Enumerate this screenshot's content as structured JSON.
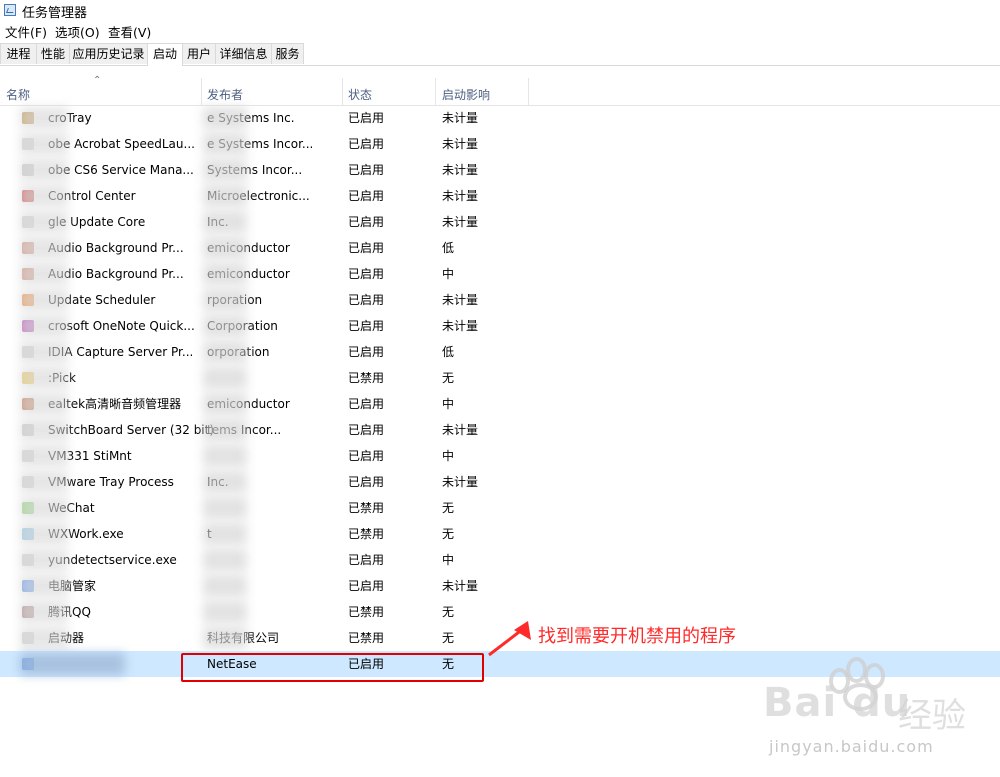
{
  "window": {
    "title": "任务管理器",
    "icon": "task-manager-icon"
  },
  "menu": [
    "文件(F)",
    "选项(O)",
    "查看(V)"
  ],
  "tabs": [
    "进程",
    "性能",
    "应用历史记录",
    "启动",
    "用户",
    "详细信息",
    "服务"
  ],
  "active_tab": "启动",
  "columns": [
    "名称",
    "发布者",
    "状态",
    "启动影响"
  ],
  "rows": [
    {
      "name": "croTray",
      "publisher": "e Systems Inc.",
      "status": "已启用",
      "impact": "未计量",
      "icon_color": "#c8a46a"
    },
    {
      "name": "obe Acrobat SpeedLau...",
      "publisher": "e Systems Incor...",
      "status": "已启用",
      "impact": "未计量",
      "icon_color": "#d9d9d9"
    },
    {
      "name": "obe CS6 Service Mana...",
      "publisher": "Systems Incor...",
      "status": "已启用",
      "impact": "未计量",
      "icon_color": "#cfcfcf"
    },
    {
      "name": "Control Center",
      "publisher": "Microelectronic...",
      "status": "已启用",
      "impact": "未计量",
      "icon_color": "#d36b6b"
    },
    {
      "name": "gle Update Core",
      "publisher": "Inc.",
      "status": "已启用",
      "impact": "未计量",
      "icon_color": "#d9d9d9"
    },
    {
      "name": "Audio Background Pr...",
      "publisher": "emiconductor",
      "status": "已启用",
      "impact": "低",
      "icon_color": "#d8a090"
    },
    {
      "name": "Audio Background Pr...",
      "publisher": "emiconductor",
      "status": "已启用",
      "impact": "中",
      "icon_color": "#d8a090"
    },
    {
      "name": "Update Scheduler",
      "publisher": "rporation",
      "status": "已启用",
      "impact": "未计量",
      "icon_color": "#f0a060"
    },
    {
      "name": "crosoft OneNote Quick...",
      "publisher": "Corporation",
      "status": "已启用",
      "impact": "未计量",
      "icon_color": "#c06ac0"
    },
    {
      "name": "IDIA Capture Server Pr...",
      "publisher": "orporation",
      "status": "已启用",
      "impact": "低",
      "icon_color": "#d9d9d9"
    },
    {
      "name": ":Pick",
      "publisher": "",
      "status": "已禁用",
      "impact": "无",
      "icon_color": "#f0d070"
    },
    {
      "name": "ealtek高清晰音频管理器",
      "publisher": "emiconductor",
      "status": "已启用",
      "impact": "中",
      "icon_color": "#c98b6b"
    },
    {
      "name": "SwitchBoard Server (32 bit)",
      "publisher": "tems Incor...",
      "status": "已启用",
      "impact": "未计量",
      "icon_color": "#d0d0d0"
    },
    {
      "name": "VM331 StiMnt",
      "publisher": "",
      "status": "已启用",
      "impact": "中",
      "icon_color": "#d9d9d9"
    },
    {
      "name": "VMware Tray Process",
      "publisher": "Inc.",
      "status": "已启用",
      "impact": "未计量",
      "icon_color": "#d9d9d9"
    },
    {
      "name": "WeChat",
      "publisher": "",
      "status": "已禁用",
      "impact": "无",
      "icon_color": "#9fdb8d"
    },
    {
      "name": "WXWork.exe",
      "publisher": "t",
      "status": "已禁用",
      "impact": "无",
      "icon_color": "#9fd0ec"
    },
    {
      "name": "yundetectservice.exe",
      "publisher": "",
      "status": "已启用",
      "impact": "中",
      "icon_color": "#d9d9d9"
    },
    {
      "name": "电脑管家",
      "publisher": "",
      "status": "已启用",
      "impact": "未计量",
      "icon_color": "#7aa7ef"
    },
    {
      "name": "腾讯QQ",
      "publisher": "",
      "status": "已禁用",
      "impact": "无",
      "icon_color": "#b79a9a"
    },
    {
      "name": "启动器",
      "publisher": "科技有限公司",
      "status": "已禁用",
      "impact": "无",
      "icon_color": "#d9d9d9"
    },
    {
      "name": "",
      "publisher": "NetEase",
      "status": "已启用",
      "impact": "无",
      "icon_color": "#7aa7ef",
      "selected": true
    }
  ],
  "annotation": {
    "text": "找到需要开机禁用的程序",
    "color": "#ff2a2a"
  },
  "watermark": {
    "logo": "Bai  du",
    "text": "经验",
    "url": "jingyan.baidu.com"
  }
}
